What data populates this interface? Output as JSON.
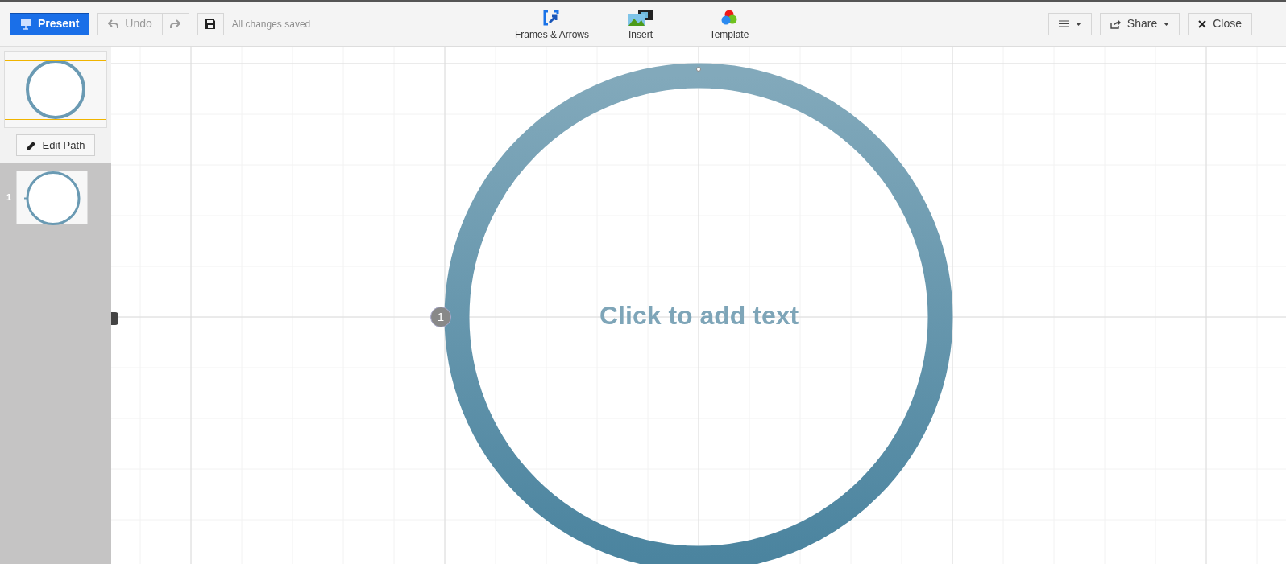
{
  "toolbar": {
    "present": "Present",
    "history": {
      "undo": "Undo",
      "disabled": true
    },
    "save_status": "All changes saved",
    "tools": [
      {
        "label": "Frames & Arrows",
        "kind": "frames"
      },
      {
        "label": "Insert",
        "kind": "insert"
      },
      {
        "label": "Template",
        "kind": "template"
      }
    ],
    "share": "Share",
    "close": "Close"
  },
  "sidebar": {
    "edit_path": "Edit Path",
    "slides": [
      {
        "number": "1"
      }
    ]
  },
  "canvas": {
    "placeholder_text": "Click to add text",
    "path_marker": "1"
  }
}
